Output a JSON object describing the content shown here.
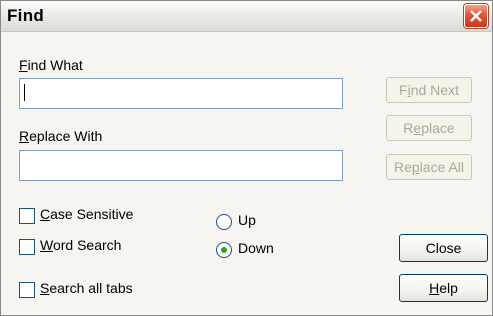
{
  "dialog": {
    "title": "Find"
  },
  "find_what": {
    "label_underlined": "F",
    "label_rest": "ind What",
    "value": ""
  },
  "replace_with": {
    "label_underlined": "R",
    "label_rest": "eplace With",
    "value": ""
  },
  "buttons": {
    "find_next": {
      "pre": "F",
      "underlined": "i",
      "post": "nd Next",
      "enabled": false
    },
    "replace": {
      "pre": "R",
      "underlined": "e",
      "post": "place",
      "enabled": false
    },
    "replace_all": {
      "pre": "Re",
      "underlined": "p",
      "post": "lace All",
      "enabled": false
    },
    "close": {
      "label": "Close",
      "enabled": true
    },
    "help": {
      "underlined": "H",
      "post": "elp",
      "enabled": true
    }
  },
  "options": {
    "case_sensitive": {
      "underlined": "C",
      "post": "ase Sensitive",
      "checked": false
    },
    "word_search": {
      "underlined": "W",
      "post": "ord Search",
      "checked": false
    },
    "search_all_tabs": {
      "underlined": "S",
      "post": "earch all tabs",
      "checked": false
    }
  },
  "direction": {
    "up": {
      "label": "Up",
      "selected": false
    },
    "down": {
      "label": "Down",
      "selected": true
    }
  },
  "colors": {
    "close_button": "#e0563a",
    "radio_dot": "#2fa51e",
    "disabled_text": "#aca899"
  }
}
